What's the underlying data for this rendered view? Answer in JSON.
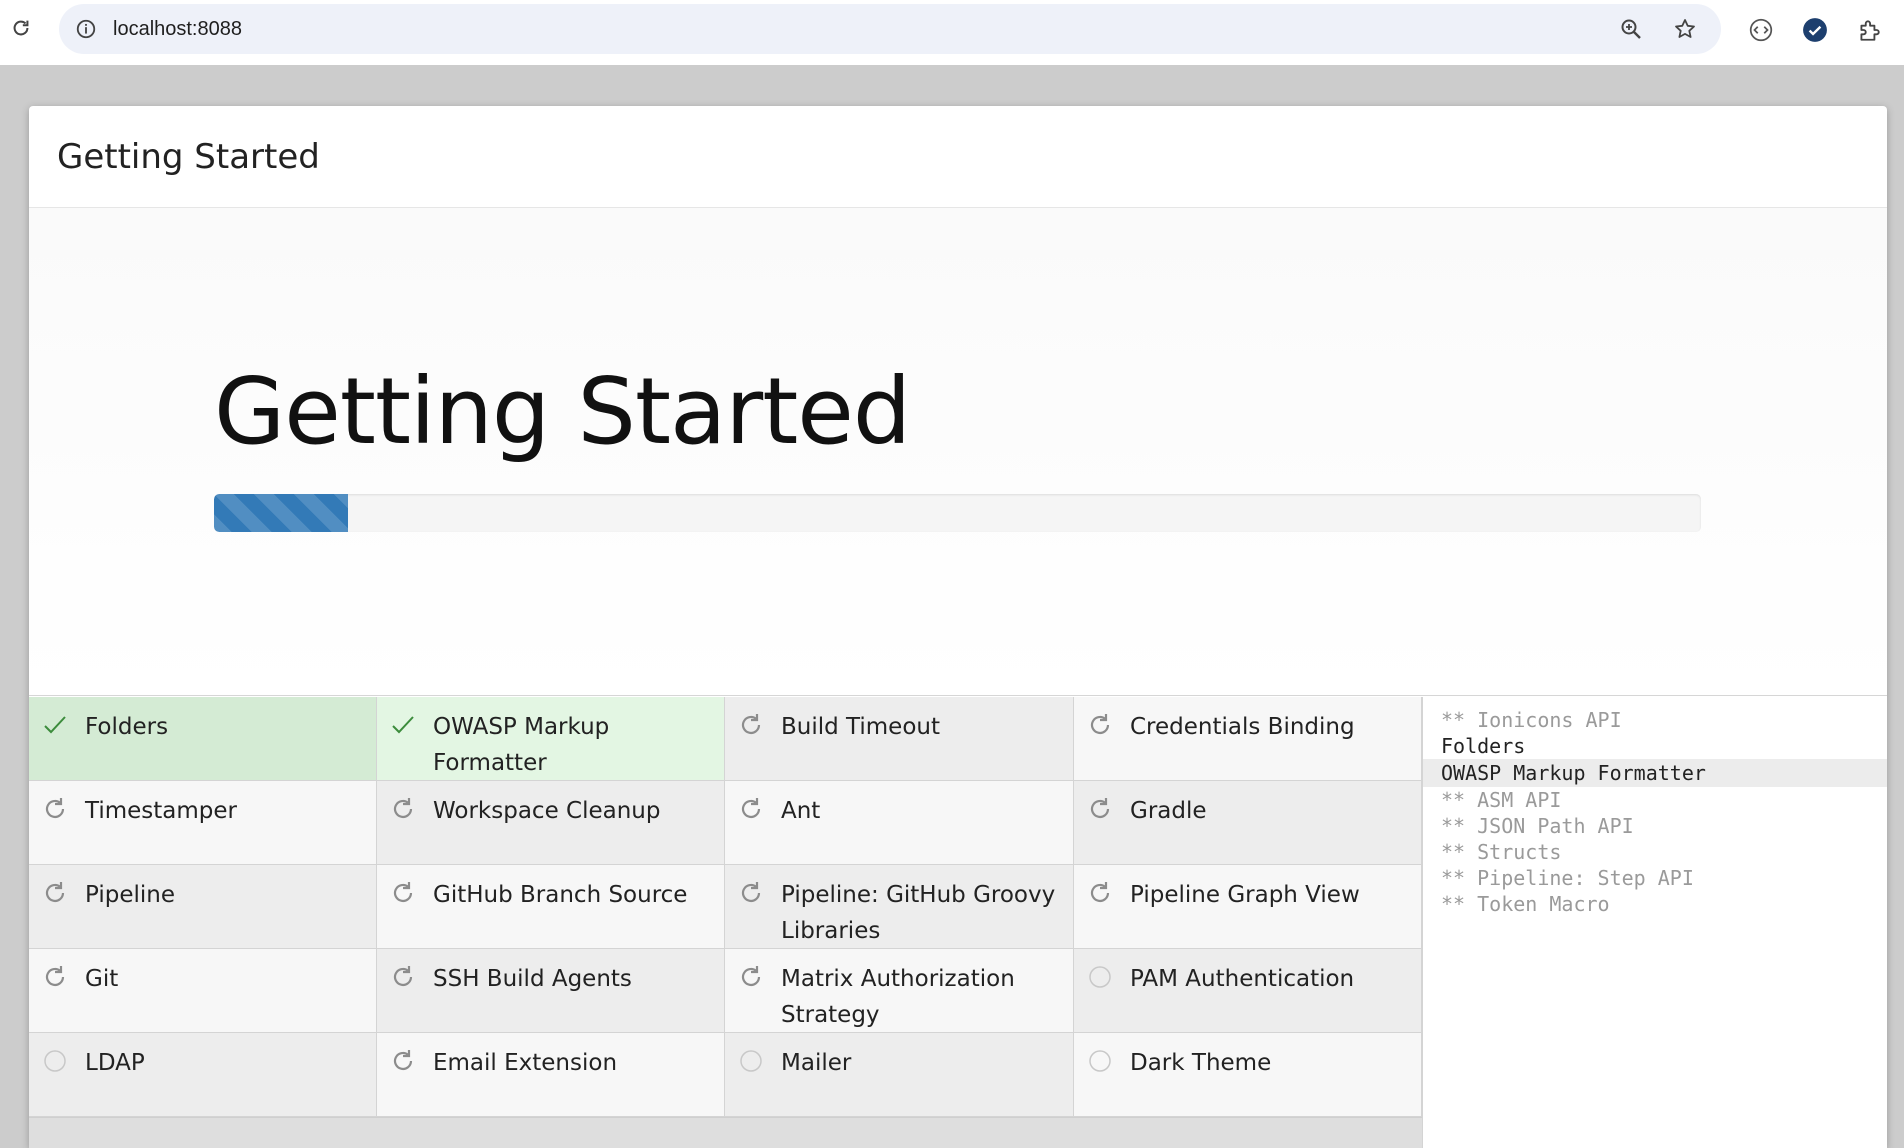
{
  "browser": {
    "url": "localhost:8088"
  },
  "wizard": {
    "header_title": "Getting Started",
    "banner_title": "Getting Started",
    "progress_percent": 9
  },
  "plugins": [
    {
      "name": "Folders",
      "status": "success",
      "icon": "check-icon"
    },
    {
      "name": "OWASP Markup Formatter",
      "status": "success",
      "icon": "check-icon"
    },
    {
      "name": "Build Timeout",
      "status": "installing",
      "icon": "refresh-icon"
    },
    {
      "name": "Credentials Binding",
      "status": "installing",
      "icon": "refresh-icon"
    },
    {
      "name": "Timestamper",
      "status": "installing",
      "icon": "refresh-icon"
    },
    {
      "name": "Workspace Cleanup",
      "status": "installing",
      "icon": "refresh-icon"
    },
    {
      "name": "Ant",
      "status": "installing",
      "icon": "refresh-icon"
    },
    {
      "name": "Gradle",
      "status": "installing",
      "icon": "refresh-icon"
    },
    {
      "name": "Pipeline",
      "status": "installing",
      "icon": "refresh-icon"
    },
    {
      "name": "GitHub Branch Source",
      "status": "installing",
      "icon": "refresh-icon"
    },
    {
      "name": "Pipeline: GitHub Groovy Libraries",
      "status": "installing",
      "icon": "refresh-icon"
    },
    {
      "name": "Pipeline Graph View",
      "status": "installing",
      "icon": "refresh-icon"
    },
    {
      "name": "Git",
      "status": "installing",
      "icon": "refresh-icon"
    },
    {
      "name": "SSH Build Agents",
      "status": "installing",
      "icon": "refresh-icon"
    },
    {
      "name": "Matrix Authorization Strategy",
      "status": "installing",
      "icon": "refresh-icon"
    },
    {
      "name": "PAM Authentication",
      "status": "pending",
      "icon": "circle-icon"
    },
    {
      "name": "LDAP",
      "status": "pending",
      "icon": "circle-icon"
    },
    {
      "name": "Email Extension",
      "status": "installing",
      "icon": "refresh-icon"
    },
    {
      "name": "Mailer",
      "status": "pending",
      "icon": "circle-icon"
    },
    {
      "name": "Dark Theme",
      "status": "pending",
      "icon": "circle-icon"
    }
  ],
  "install_log": [
    {
      "text": "** Ionicons API",
      "type": "dep"
    },
    {
      "text": "Folders",
      "type": "done"
    },
    {
      "text": "OWASP Markup Formatter",
      "type": "current"
    },
    {
      "text": "** ASM API",
      "type": "dep"
    },
    {
      "text": "** JSON Path API",
      "type": "dep"
    },
    {
      "text": "** Structs",
      "type": "dep"
    },
    {
      "text": "** Pipeline: Step API",
      "type": "dep"
    },
    {
      "text": "** Token Macro",
      "type": "dep"
    }
  ],
  "colors": {
    "progress": "#337ab7",
    "success_bg": "#d4ebd4",
    "icon_gray": "#8c8c8c",
    "check_green": "#3c8c3c"
  }
}
